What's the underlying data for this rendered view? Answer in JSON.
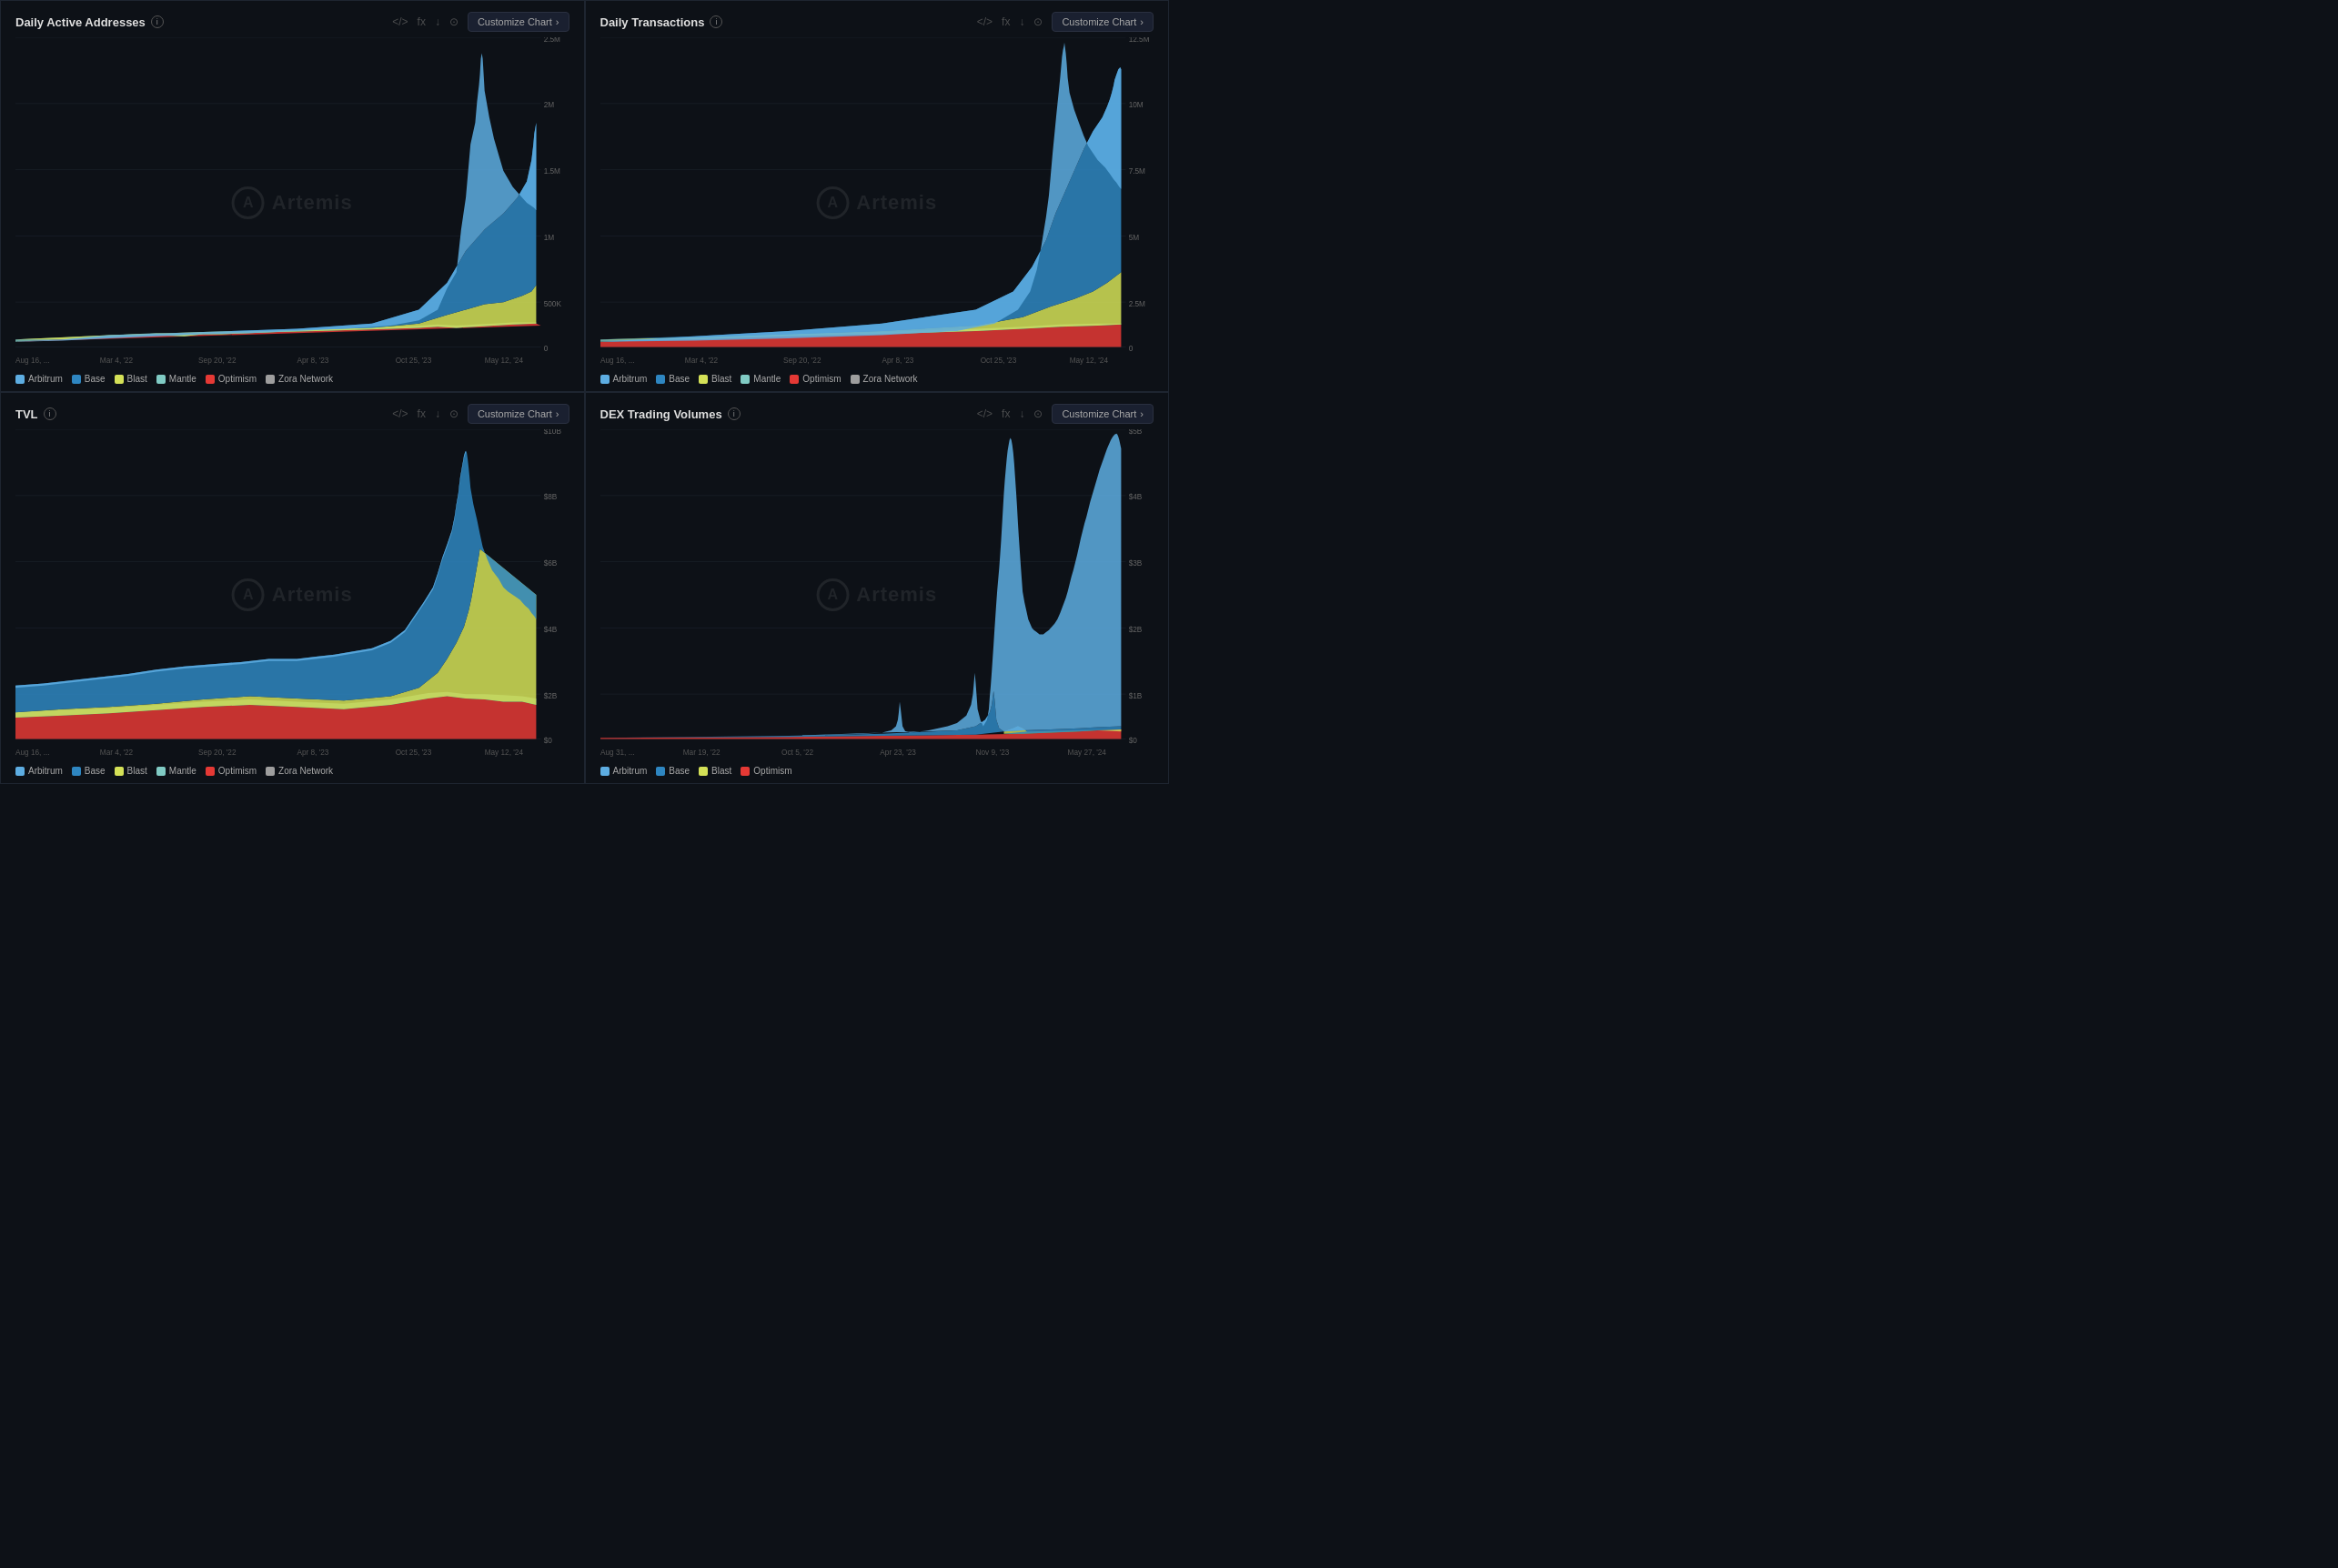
{
  "charts": [
    {
      "id": "daily-active-addresses",
      "title": "Daily Active Addresses",
      "customize_label": "Customize Chart",
      "y_labels": [
        "2.5M",
        "2M",
        "1.5M",
        "1M",
        "500K",
        "0"
      ],
      "x_labels": [
        "Aug 16, ...",
        "Mar 4, '22",
        "Sep 20, '22",
        "Apr 8, '23",
        "Oct 25, '23",
        "May 12, '24"
      ],
      "legends": [
        {
          "name": "Arbitrum",
          "color": "#5dade2"
        },
        {
          "name": "Base",
          "color": "#2e86c1"
        },
        {
          "name": "Blast",
          "color": "#d4e157"
        },
        {
          "name": "Mantle",
          "color": "#80cbc4"
        },
        {
          "name": "Optimism",
          "color": "#e53935"
        },
        {
          "name": "Zora Network",
          "color": "#9e9e9e"
        }
      ]
    },
    {
      "id": "daily-transactions",
      "title": "Daily Transactions",
      "customize_label": "Customize Chart",
      "y_labels": [
        "12.5M",
        "10M",
        "7.5M",
        "5M",
        "2.5M",
        "0"
      ],
      "x_labels": [
        "Aug 16, ...",
        "Mar 4, '22",
        "Sep 20, '22",
        "Apr 8, '23",
        "Oct 25, '23",
        "May 12, '24"
      ],
      "legends": [
        {
          "name": "Arbitrum",
          "color": "#5dade2"
        },
        {
          "name": "Base",
          "color": "#2e86c1"
        },
        {
          "name": "Blast",
          "color": "#d4e157"
        },
        {
          "name": "Mantle",
          "color": "#80cbc4"
        },
        {
          "name": "Optimism",
          "color": "#e53935"
        },
        {
          "name": "Zora Network",
          "color": "#9e9e9e"
        }
      ]
    },
    {
      "id": "tvl",
      "title": "TVL",
      "customize_label": "Customize Chart",
      "y_labels": [
        "$10B",
        "$8B",
        "$6B",
        "$4B",
        "$2B",
        "$0"
      ],
      "x_labels": [
        "Aug 16, ...",
        "Mar 4, '22",
        "Sep 20, '22",
        "Apr 8, '23",
        "Oct 25, '23",
        "May 12, '24"
      ],
      "legends": [
        {
          "name": "Arbitrum",
          "color": "#5dade2"
        },
        {
          "name": "Base",
          "color": "#2e86c1"
        },
        {
          "name": "Blast",
          "color": "#d4e157"
        },
        {
          "name": "Mantle",
          "color": "#80cbc4"
        },
        {
          "name": "Optimism",
          "color": "#e53935"
        },
        {
          "name": "Zora Network",
          "color": "#9e9e9e"
        }
      ]
    },
    {
      "id": "dex-trading-volumes",
      "title": "DEX Trading Volumes",
      "customize_label": "Customize Chart",
      "y_labels": [
        "$5B",
        "$4B",
        "$3B",
        "$2B",
        "$1B",
        "$0"
      ],
      "x_labels": [
        "Aug 31, ...",
        "Mar 19, '22",
        "Oct 5, '22",
        "Apr 23, '23",
        "Nov 9, '23",
        "May 27, '24"
      ],
      "legends": [
        {
          "name": "Arbitrum",
          "color": "#5dade2"
        },
        {
          "name": "Base",
          "color": "#2e86c1"
        },
        {
          "name": "Blast",
          "color": "#d4e157"
        },
        {
          "name": "Optimism",
          "color": "#e53935"
        }
      ]
    }
  ],
  "icons": {
    "code": "</>",
    "fx": "fx",
    "download": "↓",
    "camera": "⊙",
    "chevron": "›",
    "info": "i",
    "artemis_logo": "A"
  }
}
